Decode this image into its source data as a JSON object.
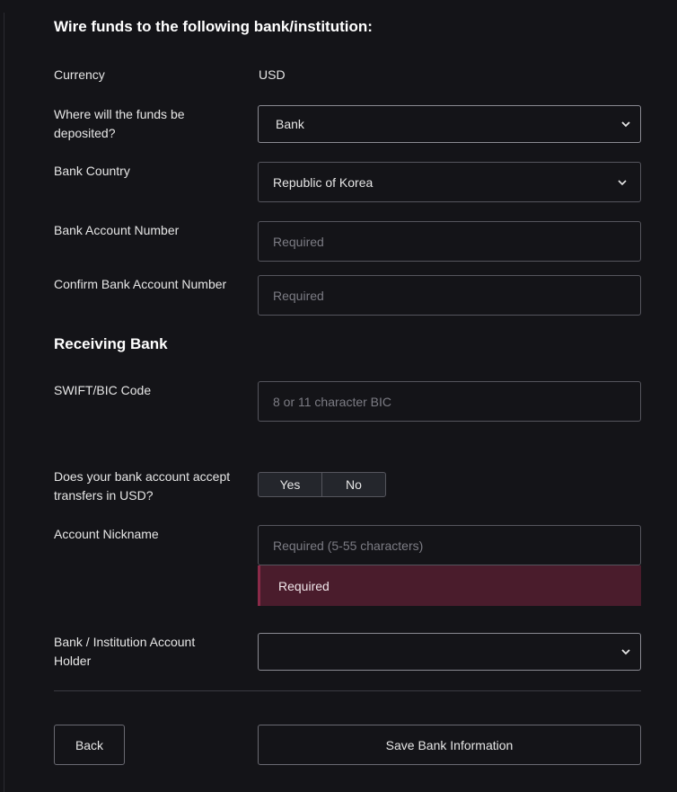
{
  "title": "Wire funds to the following bank/institution:",
  "currency": {
    "label": "Currency",
    "value": "USD"
  },
  "deposit_type": {
    "label": "Where will the funds be deposited?",
    "value": "Bank"
  },
  "bank_country": {
    "label": "Bank Country",
    "value": "Republic of Korea"
  },
  "account_number": {
    "label": "Bank Account Number",
    "placeholder": "Required"
  },
  "confirm_account_number": {
    "label": "Confirm Bank Account Number",
    "placeholder": "Required"
  },
  "receiving_bank": {
    "heading": "Receiving Bank"
  },
  "swift": {
    "label": "SWIFT/BIC Code",
    "placeholder": "8 or 11 character BIC"
  },
  "usd_transfers": {
    "label": "Does your bank account accept transfers in USD?",
    "yes": "Yes",
    "no": "No"
  },
  "nickname": {
    "label": "Account Nickname",
    "placeholder": "Required (5-55 characters)",
    "error": "Required"
  },
  "account_holder": {
    "label": "Bank / Institution Account Holder",
    "value": ""
  },
  "buttons": {
    "back": "Back",
    "save": "Save Bank Information"
  },
  "colors": {
    "background": "#141418",
    "error_bg": "#4a1c2c",
    "border": "#55555d"
  }
}
